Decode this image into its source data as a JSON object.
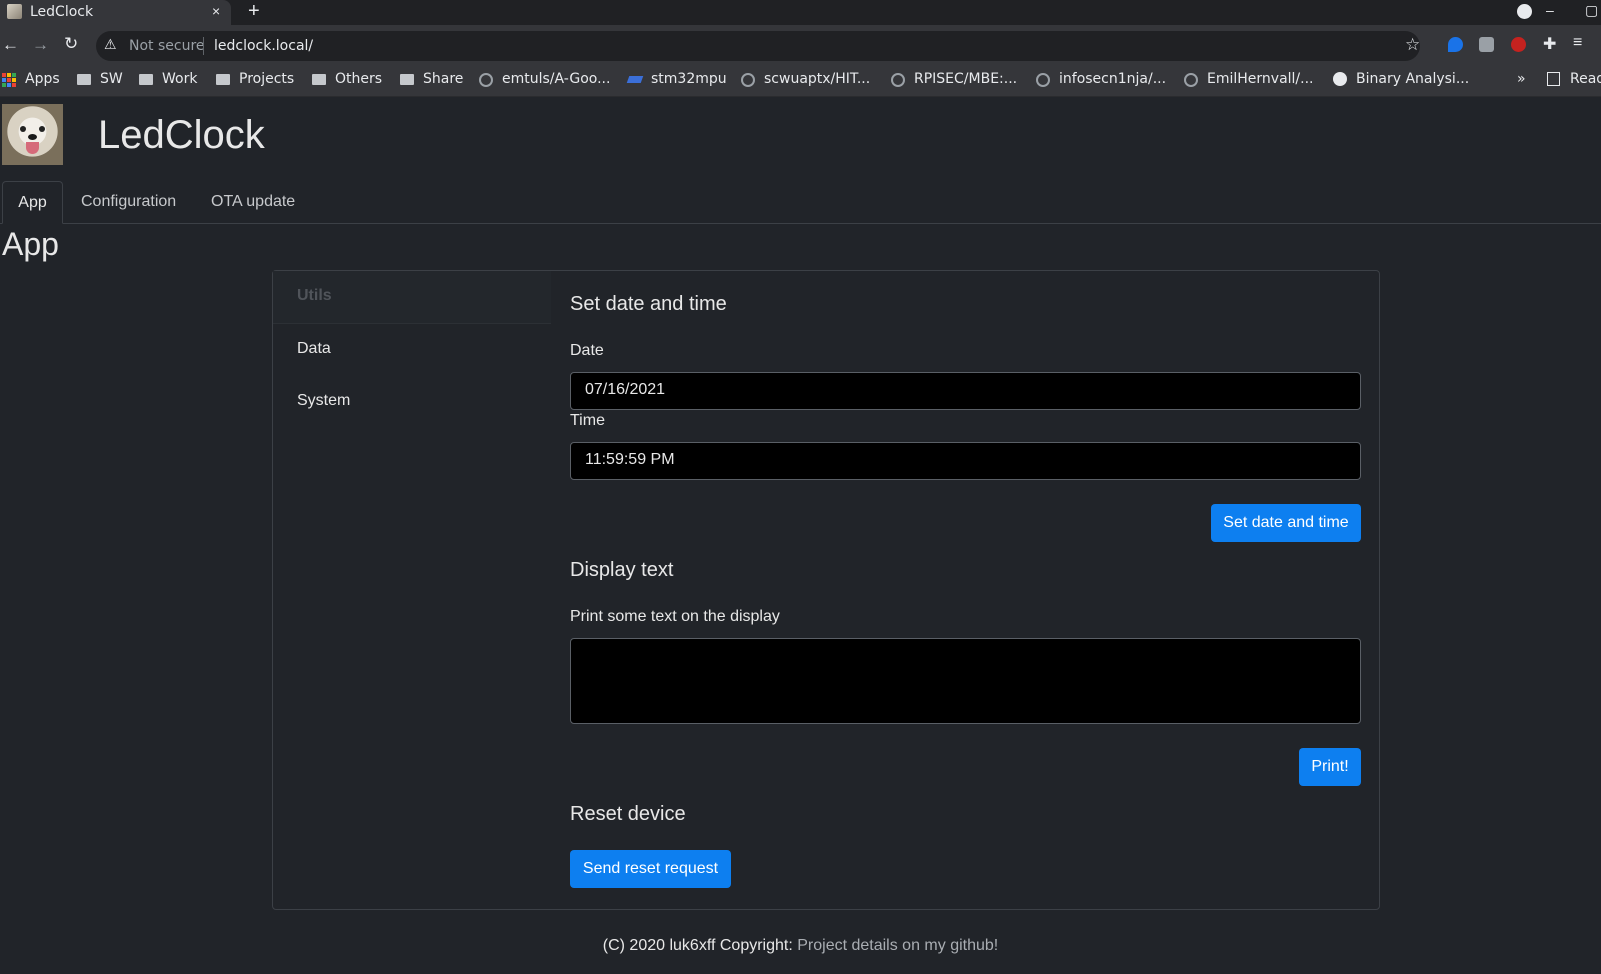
{
  "browser": {
    "tab_title": "LedClock",
    "tab_close": "×",
    "new_tab": "+",
    "security_label": "Not secure",
    "url": "ledclock.local/",
    "bookmarks_overflow": "»",
    "reading_list": "Read",
    "bookmarks": [
      {
        "label": "Apps",
        "icon": "apps-grid-icon"
      },
      {
        "label": "SW",
        "icon": "folder-icon"
      },
      {
        "label": "Work",
        "icon": "folder-icon"
      },
      {
        "label": "Projects",
        "icon": "folder-icon"
      },
      {
        "label": "Others",
        "icon": "folder-icon"
      },
      {
        "label": "Share",
        "icon": "folder-icon"
      },
      {
        "label": "emtuls/A-Goo...",
        "icon": "github-icon"
      },
      {
        "label": "stm32mpu",
        "icon": "st-icon"
      },
      {
        "label": "scwuaptx/HIT...",
        "icon": "github-icon"
      },
      {
        "label": "RPISEC/MBE:...",
        "icon": "github-icon"
      },
      {
        "label": "infosecn1nja/...",
        "icon": "github-icon"
      },
      {
        "label": "EmilHernvall/...",
        "icon": "github-icon"
      },
      {
        "label": "Binary Analysi...",
        "icon": "globe-icon"
      }
    ]
  },
  "app": {
    "brand": "LedClock",
    "tabs": [
      {
        "label": "App",
        "active": true
      },
      {
        "label": "Configuration",
        "active": false
      },
      {
        "label": "OTA update",
        "active": false
      }
    ],
    "page_heading": "App",
    "sidebar": {
      "header": "Utils",
      "items": [
        "Data",
        "System"
      ]
    },
    "datetime": {
      "title": "Set date and time",
      "date_label": "Date",
      "date_value": "07/16/2021",
      "time_label": "Time",
      "time_value": "11:59:59 PM",
      "button": "Set date and time"
    },
    "display_text": {
      "title": "Display text",
      "label": "Print some text on the display",
      "value": "",
      "button": "Print!"
    },
    "reset": {
      "title": "Reset device",
      "button": "Send reset request"
    },
    "footer": {
      "copyright": "(C) 2020 luk6xff Copyright:",
      "link": "Project details on my github!"
    }
  },
  "colors": {
    "accent": "#0d7ff0",
    "page_bg": "#212429",
    "input_bg": "#000000"
  }
}
